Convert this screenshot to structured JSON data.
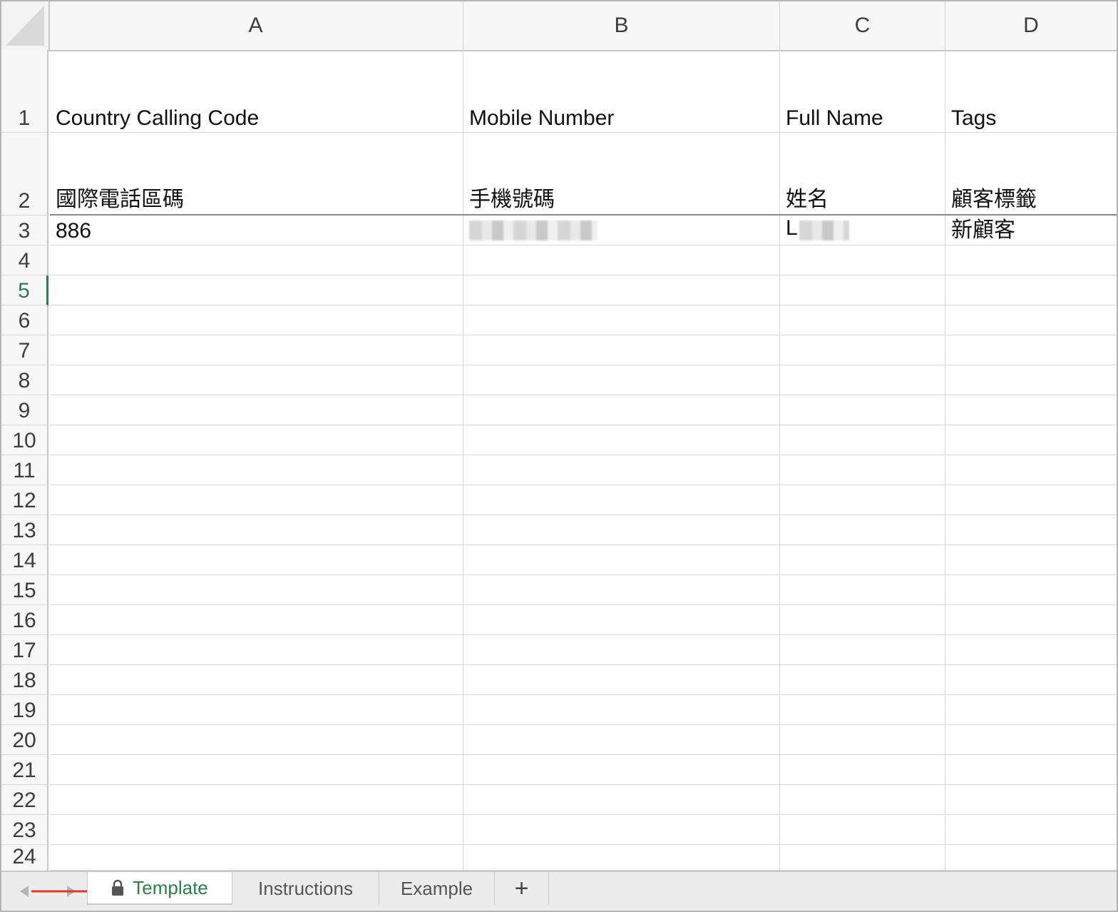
{
  "columns": [
    "A",
    "B",
    "C",
    "D"
  ],
  "rows": [
    {
      "num": "1",
      "cells": [
        "Country Calling Code",
        "Mobile Number",
        "Full Name",
        "Tags"
      ]
    },
    {
      "num": "2",
      "cells": [
        "國際電話區碼",
        "手機號碼",
        "姓名",
        "顧客標籤"
      ]
    },
    {
      "num": "3",
      "cells": [
        "886",
        "",
        "L",
        "新顧客"
      ]
    },
    {
      "num": "4"
    },
    {
      "num": "5"
    },
    {
      "num": "6"
    },
    {
      "num": "7"
    },
    {
      "num": "8"
    },
    {
      "num": "9"
    },
    {
      "num": "10"
    },
    {
      "num": "11"
    },
    {
      "num": "12"
    },
    {
      "num": "13"
    },
    {
      "num": "14"
    },
    {
      "num": "15"
    },
    {
      "num": "16"
    },
    {
      "num": "17"
    },
    {
      "num": "18"
    },
    {
      "num": "19"
    },
    {
      "num": "20"
    },
    {
      "num": "21"
    },
    {
      "num": "22"
    },
    {
      "num": "23"
    },
    {
      "num": "24"
    }
  ],
  "active_row": "5",
  "tabs": {
    "template": "Template",
    "instructions": "Instructions",
    "example": "Example",
    "add": "+"
  },
  "icons": {
    "lock": "lock-icon",
    "nav_left": "arrow-left-icon",
    "nav_right": "arrow-right-icon",
    "annotation": "red-arrow-icon"
  },
  "colors": {
    "accent": "#2e7d4a",
    "annotation": "#e0392b"
  }
}
